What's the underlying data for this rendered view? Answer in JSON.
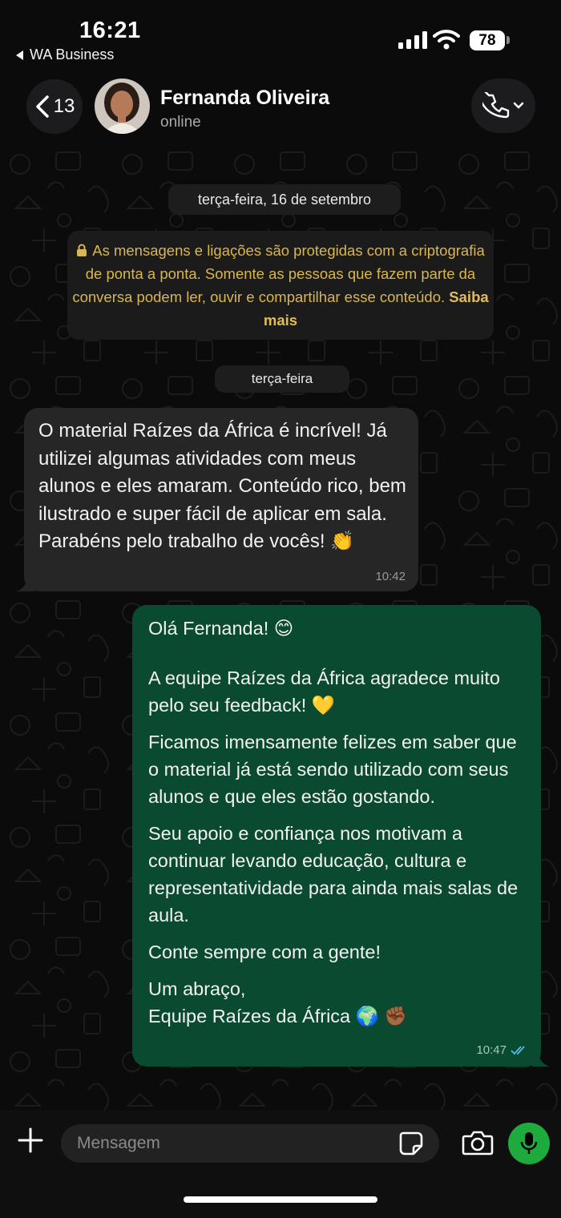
{
  "status_bar": {
    "time": "16:21",
    "back_app": "WA Business",
    "battery": "78"
  },
  "header": {
    "back_count": "13",
    "contact_name": "Fernanda Oliveira",
    "contact_status": "online"
  },
  "chat": {
    "date_chip": "terça-feira, 16 de setembro",
    "encryption_notice": "As mensagens e ligações são protegidas com a criptografia de ponta a ponta. Somente as pessoas que fazem parte da conversa podem ler, ouvir e compartilhar esse conteúdo.",
    "encryption_link": "Saiba mais",
    "day_chip": "terça-feira",
    "messages": [
      {
        "direction": "incoming",
        "text": "O material Raízes da África é incrível! Já utilizei algumas atividades com meus alunos e eles amaram. Conteúdo rico, bem ilustrado e super fácil de aplicar em sala. Parabéns pelo trabalho de vocês! 👏",
        "time": "10:42"
      },
      {
        "direction": "outgoing",
        "paragraphs": [
          "Olá Fernanda! 😊",
          "A equipe Raízes da África agradece muito pelo seu feedback! 💛",
          "Ficamos imensamente felizes em saber que o material já está sendo utilizado com seus alunos e que eles estão gostando.",
          "Seu apoio e confiança nos motivam a continuar levando educação, cultura e representatividade para ainda mais salas de aula.",
          "Conte sempre com a gente!",
          "Um abraço,\nEquipe Raízes da África 🌍 ✊🏾"
        ],
        "time": "10:47",
        "status": "read"
      }
    ]
  },
  "input": {
    "placeholder": "Mensagem"
  },
  "colors": {
    "incoming_bubble": "#262626",
    "outgoing_bubble": "#0a4a31",
    "mic_button": "#1faa3e",
    "read_ticks": "#53bdeb",
    "link": "#e2be52"
  }
}
